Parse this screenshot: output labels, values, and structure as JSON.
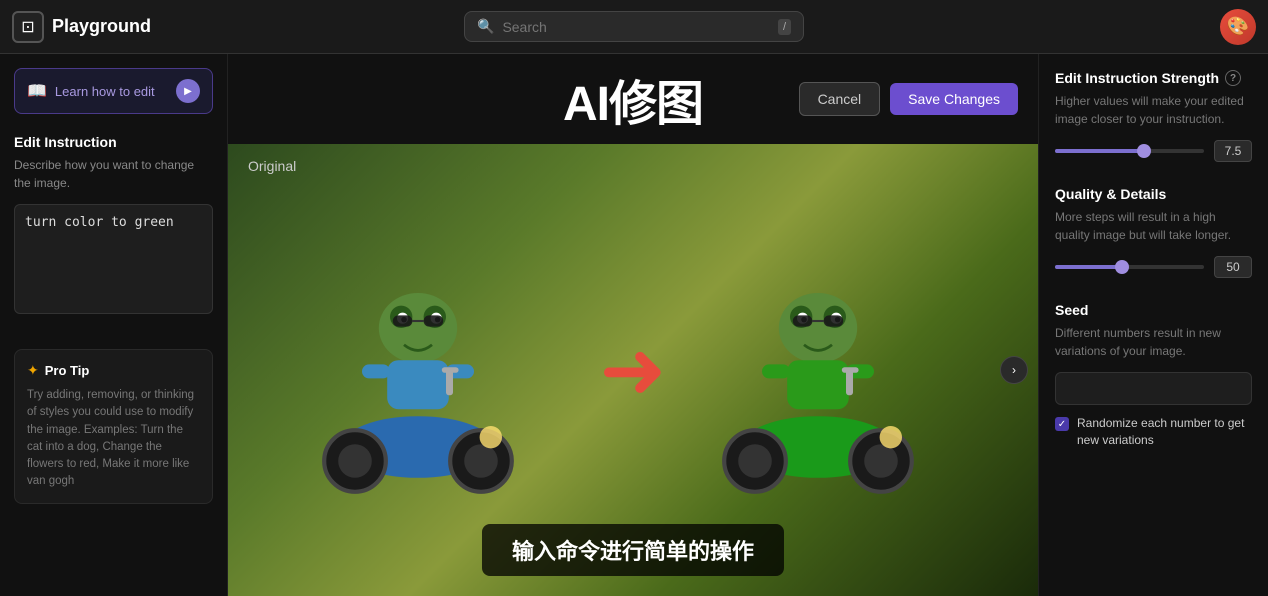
{
  "header": {
    "logo_icon": "⊡",
    "logo_text": "Playground",
    "search_placeholder": "Search",
    "search_kbd": "/",
    "avatar_emoji": "🎨"
  },
  "sidebar": {
    "learn_btn_label": "Learn how to edit",
    "edit_instruction_title": "Edit Instruction",
    "edit_instruction_desc": "Describe how you want to change the image.",
    "instruction_value": "turn color to green",
    "pro_tip_title": "Pro Tip",
    "pro_tip_text": "Try adding, removing, or thinking of styles you could use to modify the image. Examples: Turn the cat into a dog, Change the flowers to red, Make it more like van gogh"
  },
  "center": {
    "page_title": "AI修图",
    "cancel_label": "Cancel",
    "save_label": "Save Changes",
    "original_label": "Original",
    "subtitle": "输入命令进行简单的操作"
  },
  "right_panel": {
    "strength_title": "Edit Instruction Strength",
    "strength_info": "?",
    "strength_desc": "Higher values will make your edited image closer to your instruction.",
    "strength_value": "7.5",
    "strength_pct": 60,
    "quality_title": "Quality & Details",
    "quality_desc": "More steps will result in a high quality image but will take longer.",
    "quality_value": "50",
    "quality_pct": 45,
    "seed_title": "Seed",
    "seed_desc": "Different numbers result in new variations of your image.",
    "seed_placeholder": "",
    "randomize_label": "Randomize each number to get new variations"
  }
}
